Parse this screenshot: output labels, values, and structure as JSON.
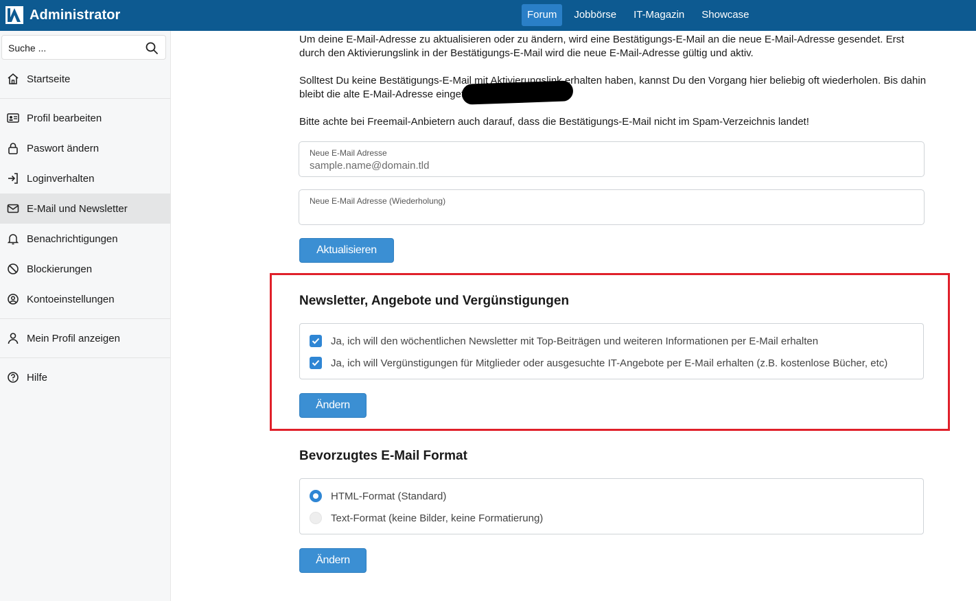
{
  "app": {
    "brand": "Administrator"
  },
  "topnav": [
    {
      "label": "Forum",
      "active": true
    },
    {
      "label": "Jobbörse",
      "active": false
    },
    {
      "label": "IT-Magazin",
      "active": false
    },
    {
      "label": "Showcase",
      "active": false
    }
  ],
  "sidebar": {
    "search_label": "Suche ...",
    "items": [
      {
        "label": "Startseite",
        "icon": "home-icon"
      },
      {
        "label": "Profil bearbeiten",
        "icon": "id-card-icon"
      },
      {
        "label": "Paswort ändern",
        "icon": "lock-icon"
      },
      {
        "label": "Loginverhalten",
        "icon": "sign-in-icon"
      },
      {
        "label": "E-Mail und Newsletter",
        "icon": "envelope-icon",
        "active": true
      },
      {
        "label": "Benachrichtigungen",
        "icon": "bell-icon"
      },
      {
        "label": "Blockierungen",
        "icon": "ban-icon"
      },
      {
        "label": "Kontoeinstellungen",
        "icon": "user-circle-icon"
      },
      {
        "label": "Mein Profil anzeigen",
        "icon": "user-icon"
      },
      {
        "label": "Hilfe",
        "icon": "question-circle-icon"
      }
    ]
  },
  "main": {
    "intro_1": "Um deine E-Mail-Adresse zu aktualisieren oder zu ändern, wird eine Bestätigungs-E-Mail an die neue E-Mail-Adresse gesendet. Erst durch den Aktivierungslink in der Bestätigungs-E-Mail wird die neue E-Mail-Adresse gültig und aktiv.",
    "intro_2": "Solltest Du keine Bestätigungs-E-Mail mit Aktivierungslink erhalten haben, kannst Du den Vorgang hier beliebig oft wiederholen. Bis dahin bleibt die alte E-Mail-Adresse eingetragen.",
    "intro_3": "Bitte achte bei Freemail-Anbietern auch darauf, dass die Bestätigungs-E-Mail nicht im Spam-Verzeichnis landet!",
    "email_field": {
      "label": "Neue E-Mail Adresse",
      "placeholder": "sample.name@domain.tld"
    },
    "email_repeat_field": {
      "label": "Neue E-Mail Adresse (Wiederholung)",
      "value": ""
    },
    "update_button": "Aktualisieren",
    "newsletter": {
      "heading": "Newsletter, Angebote und Vergünstigungen",
      "options": [
        {
          "label": "Ja, ich will den wöchentlichen Newsletter mit Top-Beiträgen und weiteren Informationen per E-Mail erhalten",
          "checked": true
        },
        {
          "label": "Ja, ich will Vergünstigungen für Mitglieder oder ausgesuchte IT-Angebote per E-Mail erhalten (z.B. kostenlose Bücher, etc)",
          "checked": true
        }
      ],
      "button": "Ändern"
    },
    "format": {
      "heading": "Bevorzugtes E-Mail Format",
      "options": [
        {
          "label": "HTML-Format (Standard)",
          "selected": true
        },
        {
          "label": "Text-Format (keine Bilder, keine Formatierung)",
          "selected": false
        }
      ],
      "button": "Ändern"
    }
  },
  "colors": {
    "topbar": "#0d5a91",
    "accent": "#3b8fd3",
    "highlight": "#e0202a"
  }
}
